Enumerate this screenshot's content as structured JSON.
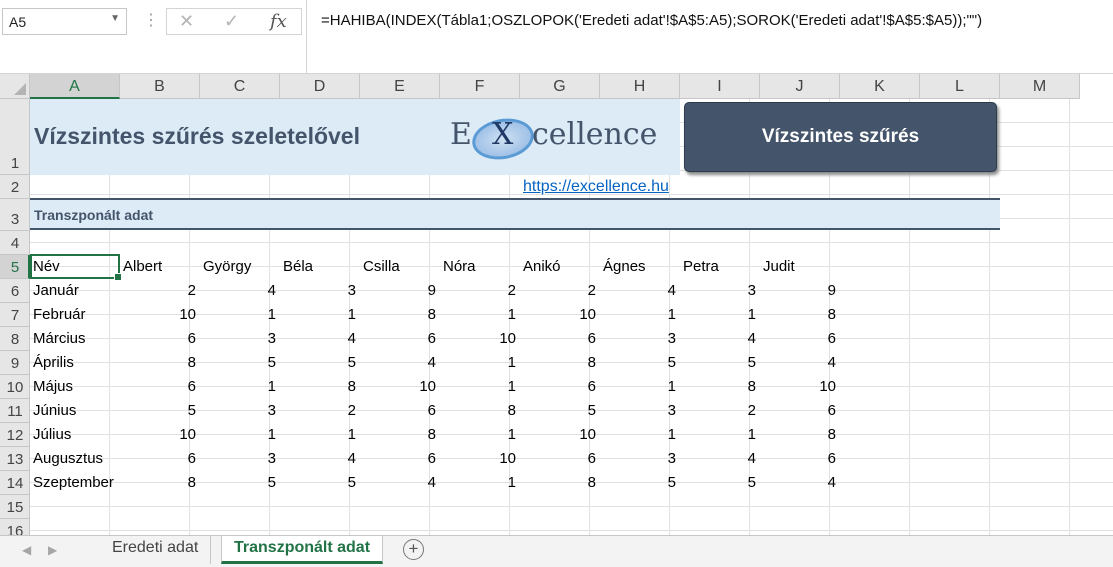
{
  "namebox": "A5",
  "formula": "=HAHIBA(INDEX(Tábla1;OSZLOPOK('Eredeti adat'!$A$5:A5);SOROK('Eredeti adat'!$A$5:$A5));\"\")",
  "columns": [
    "A",
    "B",
    "C",
    "D",
    "E",
    "F",
    "G",
    "H",
    "I",
    "J",
    "K",
    "L",
    "M"
  ],
  "rows": [
    "1",
    "2",
    "3",
    "4",
    "5",
    "6",
    "7",
    "8",
    "9",
    "10",
    "11",
    "12",
    "13",
    "14",
    "15",
    "16"
  ],
  "title": "Vízszintes szűrés szeletelővel",
  "logo": {
    "e": "E",
    "x": "X",
    "rest": "cellence"
  },
  "button": "Vízszintes szűrés",
  "link": "https://excellence.hu",
  "section": "Transzponált adat",
  "headers": [
    "Név",
    "Albert",
    "György",
    "Béla",
    "Csilla",
    "Nóra",
    "Anikó",
    "Ágnes",
    "Petra",
    "Judit"
  ],
  "months": [
    "Január",
    "Február",
    "Március",
    "Április",
    "Május",
    "Június",
    "Július",
    "Augusztus",
    "Szeptember"
  ],
  "values": [
    [
      "2",
      "4",
      "3",
      "9",
      "2",
      "2",
      "4",
      "3",
      "9"
    ],
    [
      "10",
      "1",
      "1",
      "8",
      "1",
      "10",
      "1",
      "1",
      "8"
    ],
    [
      "6",
      "3",
      "4",
      "6",
      "10",
      "6",
      "3",
      "4",
      "6"
    ],
    [
      "8",
      "5",
      "5",
      "4",
      "1",
      "8",
      "5",
      "5",
      "4"
    ],
    [
      "6",
      "1",
      "8",
      "10",
      "1",
      "6",
      "1",
      "8",
      "10"
    ],
    [
      "5",
      "3",
      "2",
      "6",
      "8",
      "5",
      "3",
      "2",
      "6"
    ],
    [
      "10",
      "1",
      "1",
      "8",
      "1",
      "10",
      "1",
      "1",
      "8"
    ],
    [
      "6",
      "3",
      "4",
      "6",
      "10",
      "6",
      "3",
      "4",
      "6"
    ],
    [
      "8",
      "5",
      "5",
      "4",
      "1",
      "8",
      "5",
      "5",
      "4"
    ]
  ],
  "tabs": [
    "Eredeti adat",
    "Transzponált adat"
  ],
  "colors": {
    "accent": "#217346",
    "header": "#44546a",
    "band": "#ddebf7",
    "link": "#0563c1"
  }
}
